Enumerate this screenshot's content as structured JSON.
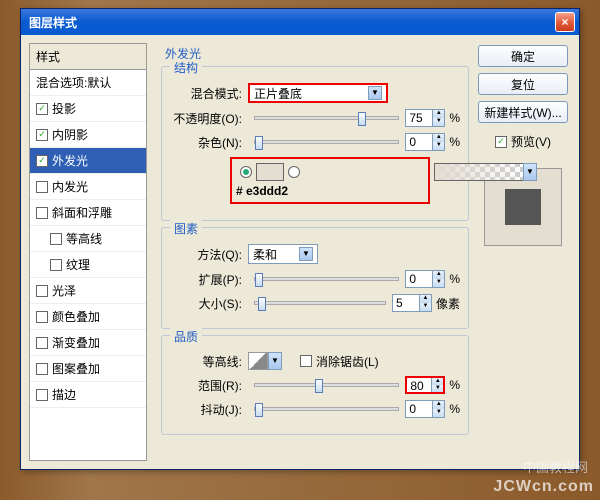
{
  "dialog": {
    "title": "图层样式"
  },
  "left": {
    "header": "样式",
    "blend_default": "混合选项:默认",
    "items": [
      {
        "label": "投影",
        "checked": true
      },
      {
        "label": "内阴影",
        "checked": true
      },
      {
        "label": "外发光",
        "checked": true,
        "selected": true
      },
      {
        "label": "内发光",
        "checked": false
      },
      {
        "label": "斜面和浮雕",
        "checked": false
      },
      {
        "label": "等高线",
        "checked": false,
        "indent": true
      },
      {
        "label": "纹理",
        "checked": false,
        "indent": true
      },
      {
        "label": "光泽",
        "checked": false
      },
      {
        "label": "颜色叠加",
        "checked": false
      },
      {
        "label": "渐变叠加",
        "checked": false
      },
      {
        "label": "图案叠加",
        "checked": false
      },
      {
        "label": "描边",
        "checked": false
      }
    ]
  },
  "mid": {
    "title": "外发光",
    "struct": {
      "legend": "结构",
      "blend_label": "混合模式:",
      "blend_value": "正片叠底",
      "opacity_label": "不透明度(O):",
      "opacity_value": "75",
      "percent": "%",
      "noise_label": "杂色(N):",
      "noise_value": "0",
      "color_hex": "# e3ddd2"
    },
    "pattern": {
      "legend": "图素",
      "method_label": "方法(Q):",
      "method_value": "柔和",
      "spread_label": "扩展(P):",
      "spread_value": "0",
      "percent": "%",
      "size_label": "大小(S):",
      "size_value": "5",
      "px": "像素"
    },
    "quality": {
      "legend": "品质",
      "contour_label": "等高线:",
      "aa_label": "消除锯齿(L)",
      "range_label": "范围(R):",
      "range_value": "80",
      "percent": "%",
      "jitter_label": "抖动(J):",
      "jitter_value": "0"
    }
  },
  "right": {
    "ok": "确定",
    "reset": "复位",
    "new_style": "新建样式(W)...",
    "preview_label": "预览(V)"
  },
  "watermark": {
    "line1": "中国教程网",
    "line2": "JCWcn.com"
  }
}
